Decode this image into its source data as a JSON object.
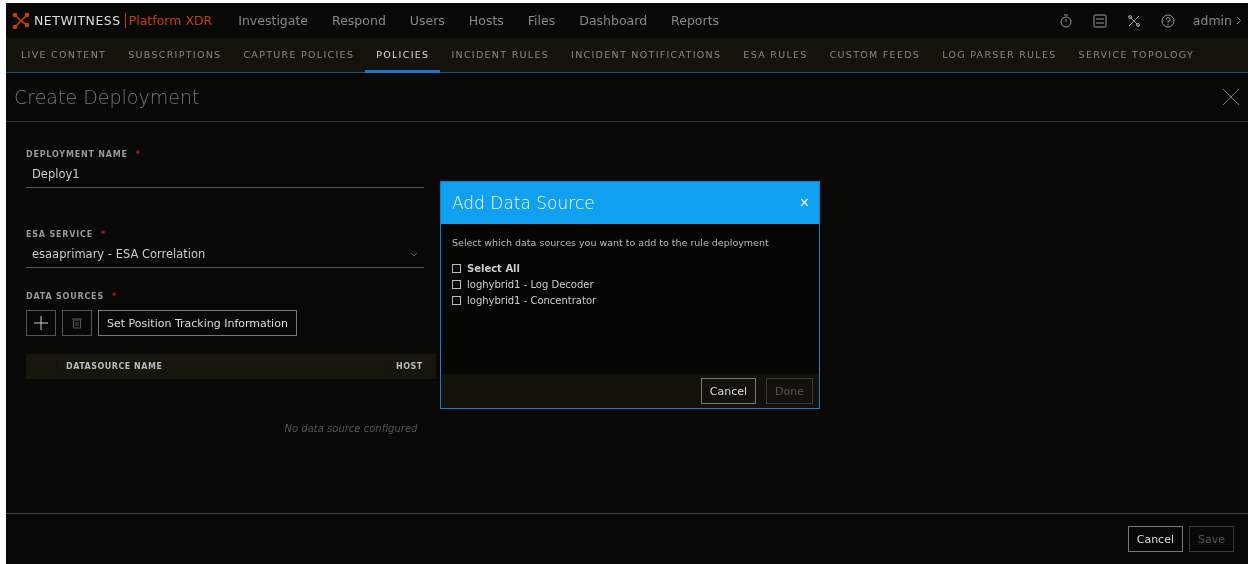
{
  "brand": {
    "name": "NETWITNESS",
    "product": "Platform XDR"
  },
  "nav": [
    {
      "label": "Investigate",
      "selected": false
    },
    {
      "label": "Respond",
      "selected": false
    },
    {
      "label": "Users",
      "selected": false
    },
    {
      "label": "Hosts",
      "selected": false
    },
    {
      "label": "Files",
      "selected": false
    },
    {
      "label": "Dashboard",
      "selected": false
    },
    {
      "label": "Reports",
      "selected": false
    }
  ],
  "user": "admin",
  "subnav": [
    {
      "label": "LIVE CONTENT",
      "selected": false
    },
    {
      "label": "SUBSCRIPTIONS",
      "selected": false
    },
    {
      "label": "CAPTURE POLICIES",
      "selected": false
    },
    {
      "label": "POLICIES",
      "selected": true
    },
    {
      "label": "INCIDENT RULES",
      "selected": false
    },
    {
      "label": "INCIDENT NOTIFICATIONS",
      "selected": false
    },
    {
      "label": "ESA RULES",
      "selected": false
    },
    {
      "label": "CUSTOM FEEDS",
      "selected": false
    },
    {
      "label": "LOG PARSER RULES",
      "selected": false
    },
    {
      "label": "SERVICE TOPOLOGY",
      "selected": false
    }
  ],
  "page_title": "Create Deployment",
  "form": {
    "deployment_name": {
      "label": "DEPLOYMENT NAME",
      "required_mark": "*",
      "value": "Deploy1"
    },
    "esa_service": {
      "label": "ESA SERVICE",
      "required_mark": "*",
      "value": "esaaprimary - ESA Correlation"
    },
    "data_sources": {
      "label": "DATA SOURCES",
      "required_mark": "*",
      "tracking_button": "Set Position Tracking Information",
      "columns": [
        "DATASOURCE NAME",
        "HOST"
      ],
      "empty_message": "No data source configured"
    }
  },
  "footer_buttons": [
    {
      "label": "Cancel",
      "disabled": false
    },
    {
      "label": "Save",
      "disabled": true
    }
  ],
  "dialog": {
    "title": "Add Data Source",
    "close": "×",
    "instruction": "Select which data sources you want to add to the rule deployment",
    "options": [
      {
        "label": "Select All",
        "checked": false,
        "kind": "all"
      },
      {
        "label": "loghybrid1 - Log Decoder",
        "checked": false,
        "kind": "item"
      },
      {
        "label": "loghybrid1 - Concentrator",
        "checked": false,
        "kind": "item"
      }
    ],
    "buttons": [
      {
        "label": "Cancel",
        "disabled": false
      },
      {
        "label": "Done",
        "disabled": true
      }
    ]
  }
}
